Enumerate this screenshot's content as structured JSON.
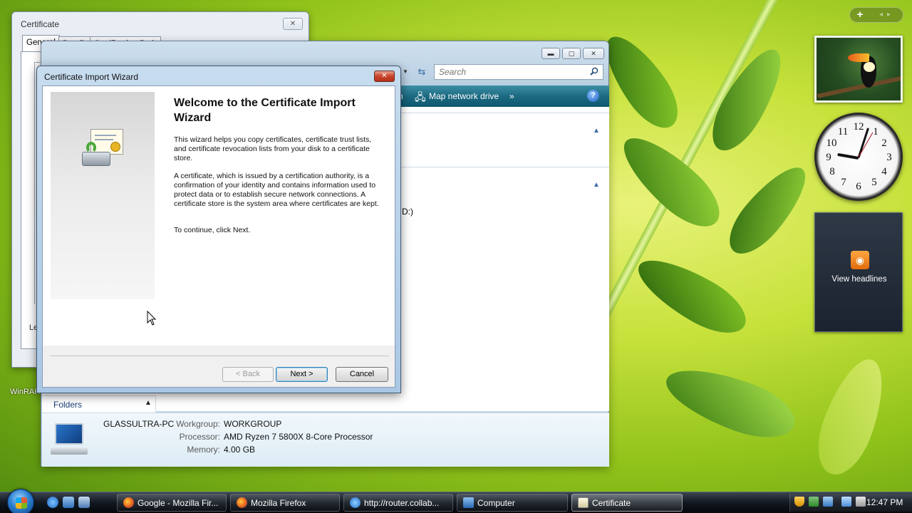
{
  "colors": {
    "desktop_accent": "#c8e23c",
    "cmdbar": "#1c6a82",
    "taskbar": "#111820",
    "wizard_frame": "#a9c7e4"
  },
  "desktop": {
    "icon_labels": [
      "WinRAR"
    ]
  },
  "sidebar": {
    "feed_label": "View headlines",
    "clock_numbers": [
      "12",
      "1",
      "2",
      "3",
      "4",
      "5",
      "6",
      "7",
      "8",
      "9",
      "10",
      "11"
    ]
  },
  "certificate_dialog": {
    "title": "Certificate",
    "tabs": [
      "General",
      "Details",
      "Certification Path"
    ],
    "partial_text": "Le"
  },
  "explorer": {
    "search_placeholder": "Search",
    "cmd": {
      "partial": "n",
      "map_drive": "Map network drive",
      "more": "»"
    },
    "partial_drive": "D:)",
    "folders_label": "Folders",
    "details": {
      "pc_name": "GLASSULTRA-PC",
      "workgroup_label": "Workgroup:",
      "workgroup": "WORKGROUP",
      "processor_label": "Processor:",
      "processor": "AMD Ryzen 7 5800X 8-Core Processor",
      "memory_label": "Memory:",
      "memory": "4.00 GB"
    }
  },
  "wizard": {
    "title": "Certificate Import Wizard",
    "heading": "Welcome to the Certificate Import Wizard",
    "p1": "This wizard helps you copy certificates, certificate trust lists, and certificate revocation lists from your disk to a certificate store.",
    "p2": "A certificate, which is issued by a certification authority, is a confirmation of your identity and contains information used to protect data or to establish secure network connections. A certificate store is the system area where certificates are kept.",
    "p3": "To continue, click Next.",
    "back": "< Back",
    "next": "Next >",
    "cancel": "Cancel"
  },
  "taskbar": {
    "buttons": [
      {
        "label": "Google - Mozilla Fir...",
        "icon": "firefox-icon"
      },
      {
        "label": "Mozilla Firefox",
        "icon": "firefox-icon"
      },
      {
        "label": "http://router.collab...",
        "icon": "ie-icon"
      },
      {
        "label": "Computer",
        "icon": "computer-icon"
      },
      {
        "label": "Certificate",
        "icon": "certificate-icon"
      }
    ],
    "time": "12:47 PM"
  }
}
